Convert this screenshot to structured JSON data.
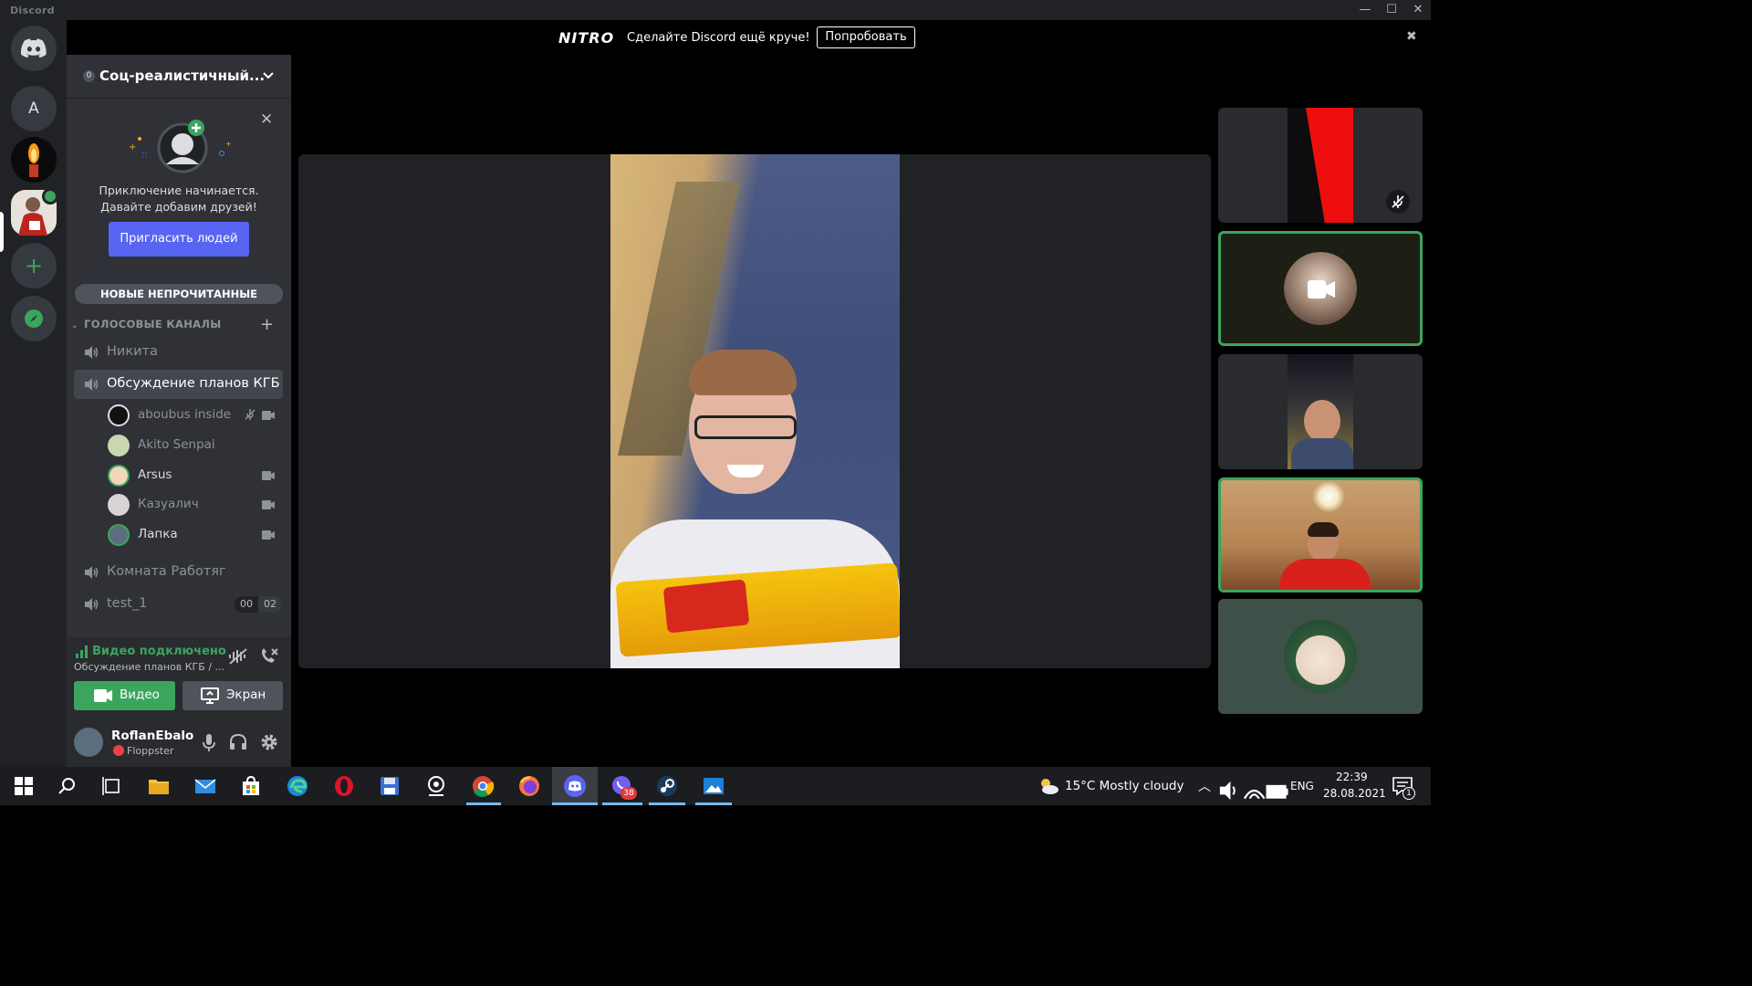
{
  "window": {
    "app_title": "Discord",
    "controls": {
      "minimize": "—",
      "maximize": "☐",
      "close": "✕"
    }
  },
  "nitro_banner": {
    "logo": "NITRO",
    "text": "Сделайте Discord ещё круче!",
    "button": "Попробовать",
    "close": "✖"
  },
  "server_rail": {
    "items": [
      {
        "name": "home",
        "label": ""
      },
      {
        "name": "server-a",
        "label": "A"
      },
      {
        "name": "server-candle",
        "label": ""
      },
      {
        "name": "server-current",
        "label": ""
      },
      {
        "name": "add-server",
        "label": "+"
      },
      {
        "name": "explore",
        "label": ""
      }
    ]
  },
  "guild": {
    "name": "Соц-реалистичный...",
    "badge": "0"
  },
  "invite_card": {
    "line1": "Приключение начинается.",
    "line2": "Давайте добавим друзей!",
    "button": "Пригласить людей",
    "close": "✕"
  },
  "unread_pill": "НОВЫЕ НЕПРОЧИТАННЫЕ",
  "voice_category": {
    "label": "ГОЛОСОВЫЕ КАНАЛЫ",
    "add": "+"
  },
  "voice_channels": [
    {
      "name": "Никита"
    },
    {
      "name": "Обсуждение планов КГБ"
    },
    {
      "name": "Комната Работяг"
    },
    {
      "name": "test_1",
      "counter_left": "00",
      "counter_right": "02"
    }
  ],
  "members": [
    {
      "name": "aboubus inside",
      "video": true,
      "muted": true
    },
    {
      "name": "Akito Senpai",
      "video": false,
      "muted": false
    },
    {
      "name": "Arsus",
      "video": true,
      "muted": false
    },
    {
      "name": "Казуалич",
      "video": true,
      "muted": false
    },
    {
      "name": "Лапка",
      "video": true,
      "muted": false
    }
  ],
  "voice_panel": {
    "status": "Видео подключено",
    "subtitle": "Обсуждение планов КГБ / ...",
    "video_button": "Видео",
    "screen_button": "Экран"
  },
  "user_panel": {
    "username": "RoflanEbalo",
    "status": "Floppster"
  },
  "taskbar": {
    "weather": "15°C  Mostly cloudy",
    "language": "ENG",
    "time": "22:39",
    "date": "28.08.2021",
    "viber_badge": "38",
    "notif_badge": "1"
  },
  "colors": {
    "discord_blurple": "#5865f2",
    "voice_green": "#3ba55d",
    "sidebar_bg": "#2f3136",
    "rail_bg": "#202225"
  }
}
